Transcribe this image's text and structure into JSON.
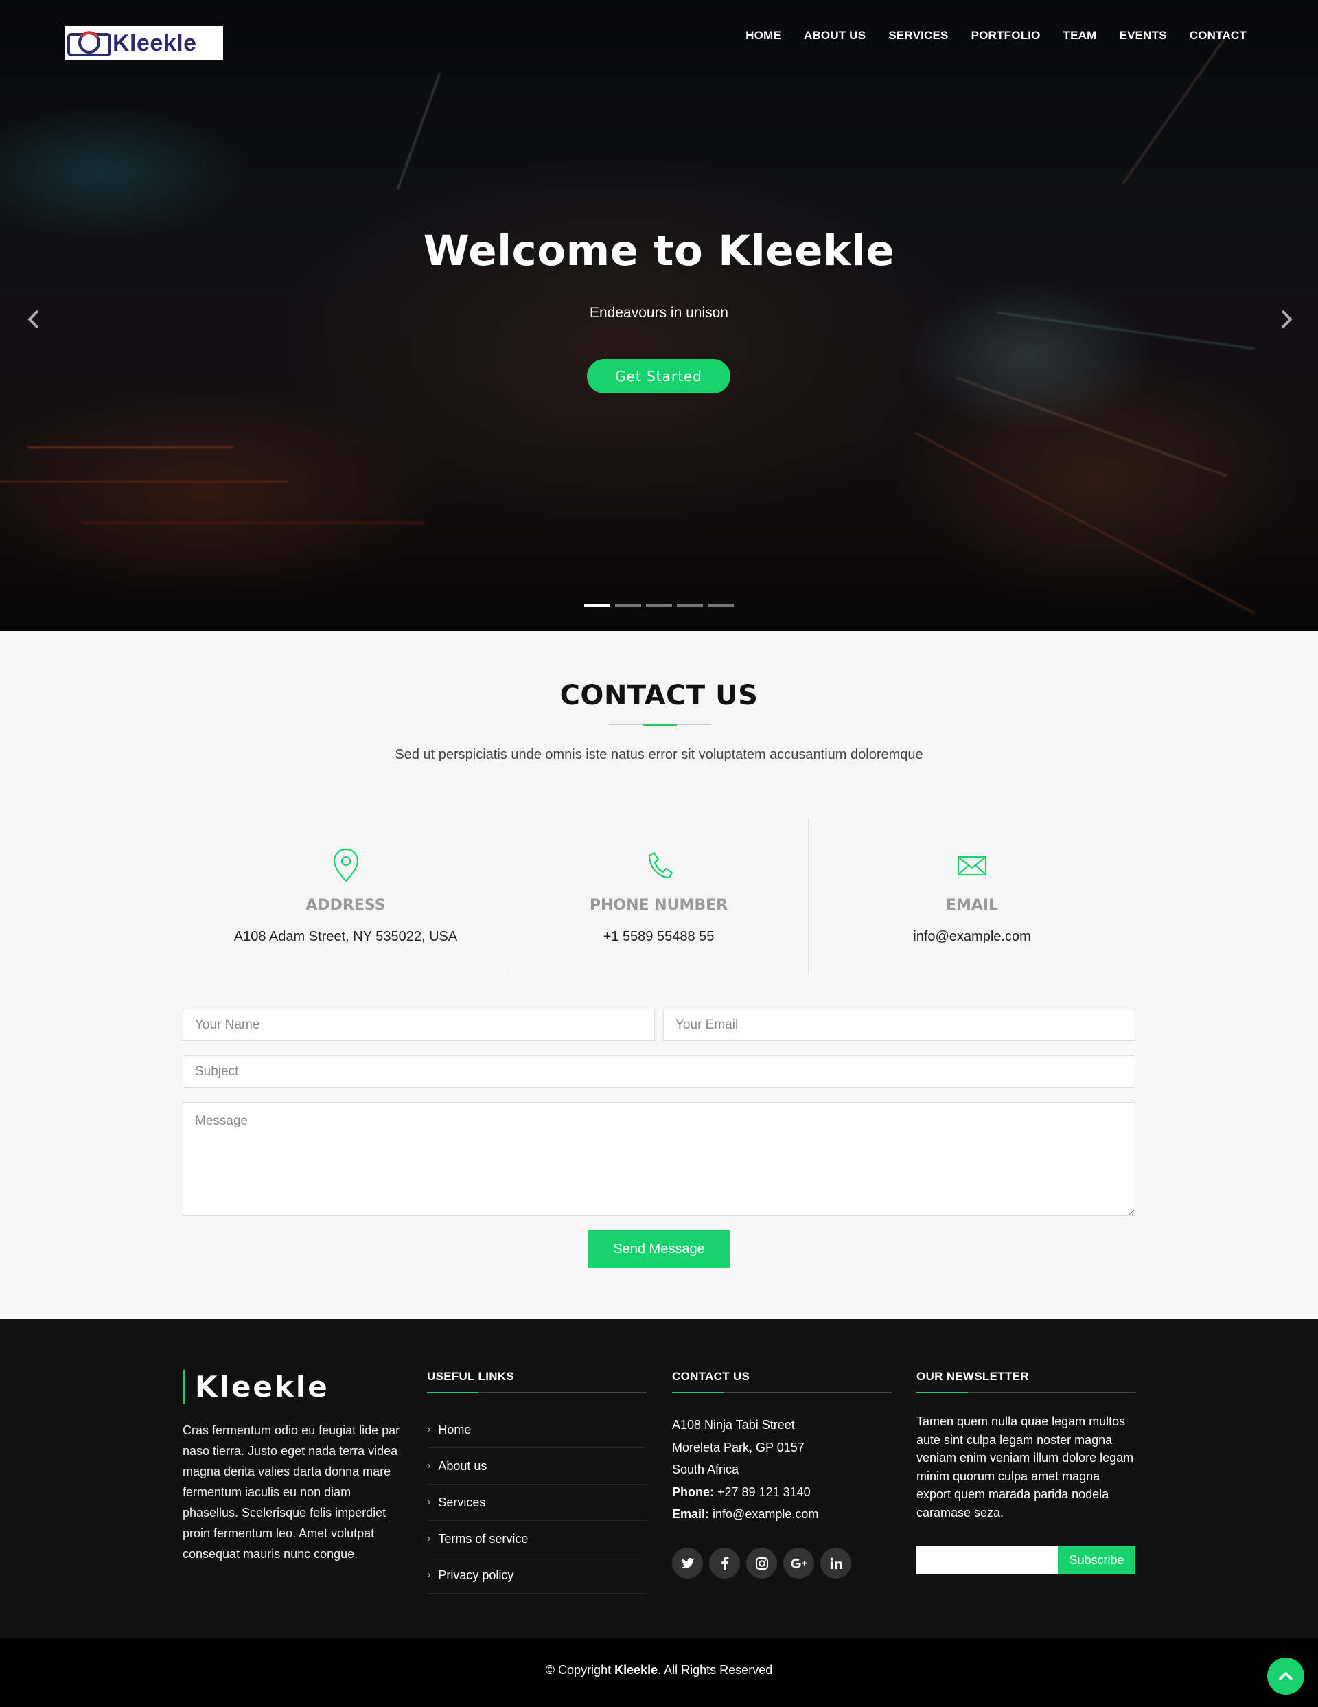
{
  "brand": {
    "logo_text": "Kleekle"
  },
  "nav": {
    "items": [
      "HOME",
      "ABOUT US",
      "SERVICES",
      "PORTFOLIO",
      "TEAM",
      "EVENTS",
      "CONTACT"
    ]
  },
  "hero": {
    "title": "Welcome to Kleekle",
    "subtitle": "Endeavours in unison",
    "cta_label": "Get Started",
    "slide_count": 5,
    "active_slide": 1
  },
  "contact": {
    "title": "CONTACT US",
    "description": "Sed ut perspiciatis unde omnis iste natus error sit voluptatem accusantium doloremque",
    "address_label": "ADDRESS",
    "address_value": "A108 Adam Street, NY 535022, USA",
    "phone_label": "PHONE NUMBER",
    "phone_value": "+1 5589 55488 55",
    "email_label": "EMAIL",
    "email_value": "info@example.com",
    "form": {
      "name_placeholder": "Your Name",
      "email_placeholder": "Your Email",
      "subject_placeholder": "Subject",
      "message_placeholder": "Message",
      "submit_label": "Send Message"
    }
  },
  "footer": {
    "brand": "Kleekle",
    "about": "Cras fermentum odio eu feugiat lide par naso tierra. Justo eget nada terra videa magna derita valies darta donna mare fermentum iaculis eu non diam phasellus. Scelerisque felis imperdiet proin fermentum leo. Amet volutpat consequat mauris nunc congue.",
    "links_title": "USEFUL LINKS",
    "links": [
      "Home",
      "About us",
      "Services",
      "Terms of service",
      "Privacy policy"
    ],
    "contact_title": "CONTACT US",
    "contact_line1": "A108 Ninja Tabi Street",
    "contact_line2": "Moreleta Park, GP 0157",
    "contact_line3": "South Africa",
    "phone_label": "Phone:",
    "phone_value": " +27 89 121 3140",
    "email_label": "Email:",
    "email_value": " info@example.com",
    "newsletter_title": "OUR NEWSLETTER",
    "newsletter_text": "Tamen quem nulla quae legam multos aute sint culpa legam noster magna veniam enim veniam illum dolore legam minim quorum culpa amet magna export quem marada parida nodela caramase seza.",
    "subscribe_label": "Subscribe",
    "social_icons": [
      "twitter-icon",
      "facebook-icon",
      "instagram-icon",
      "google-plus-icon",
      "linkedin-icon"
    ]
  },
  "copyright": {
    "prefix": "© Copyright ",
    "brand": "Kleekle",
    "suffix": ". All Rights Reserved"
  },
  "colors": {
    "accent": "#18d26e",
    "footer_bg": "#111111",
    "copyright_bg": "#000000"
  }
}
